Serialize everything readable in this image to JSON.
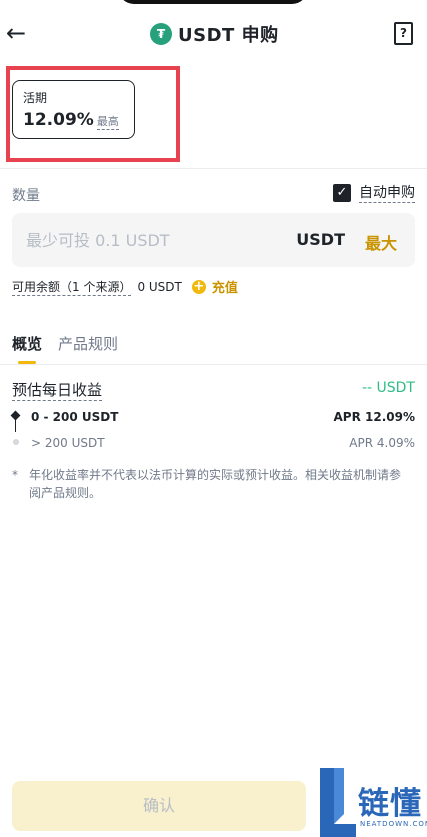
{
  "header": {
    "title": "USDT 申购",
    "coin_symbol": "₮",
    "help_symbol": "?"
  },
  "term": {
    "name": "活期",
    "rate": "12.09%",
    "max_label": "最高"
  },
  "quantity": {
    "label": "数量",
    "auto_subscribe_label": "自动申购",
    "auto_subscribe_checked": true,
    "placeholder": "最少可投 0.1 USDT",
    "unit": "USDT",
    "max_button": "最大"
  },
  "balance": {
    "label": "可用余额（1 个来源）",
    "value": "0 USDT",
    "topup_label": "充值"
  },
  "tabs": [
    {
      "label": "概览",
      "active": true
    },
    {
      "label": "产品规则",
      "active": false
    }
  ],
  "daily": {
    "label": "预估每日收益",
    "value": "-- USDT"
  },
  "tiers": [
    {
      "range": "0 - 200 USDT",
      "apr": "APR 12.09%"
    },
    {
      "range": "> 200 USDT",
      "apr": "APR 4.09%"
    }
  ],
  "note": {
    "star": "*",
    "text": "年化收益率并不代表以法币计算的实际或预计收益。相关收益机制请参阅产品规则。"
  },
  "confirm_label": "确认",
  "watermark": {
    "text": "链懂",
    "sub": "NEATDOWN.COM"
  },
  "colors": {
    "accent": "#f0b90b",
    "accent_text": "#c99400",
    "positive": "#2ebd85",
    "highlight": "#e7434f",
    "usdt": "#26a17b"
  }
}
